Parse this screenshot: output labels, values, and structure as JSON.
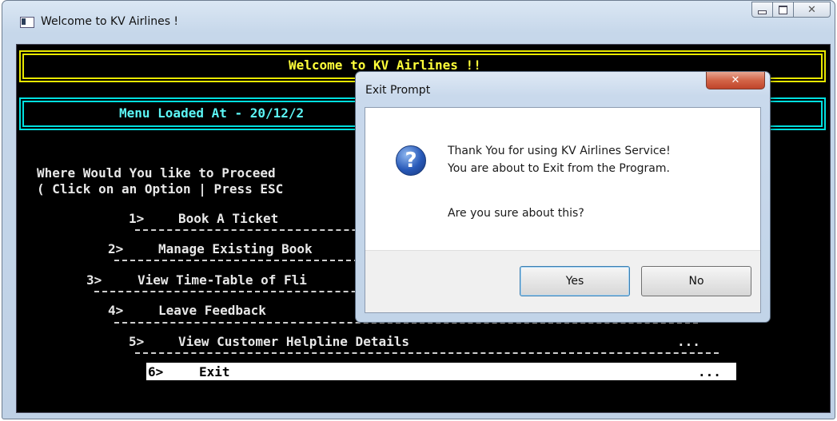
{
  "window": {
    "title": "Welcome to KV Airlines !",
    "controls": {
      "minimize": "",
      "maximize": "",
      "close": "✕"
    }
  },
  "console": {
    "banner": "Welcome to KV Airlines !!",
    "loaded": "Menu Loaded At - 20/12/2",
    "prompt_line1": "Where Would You like to Proceed",
    "prompt_line2": "( Click on an Option | Press ESC",
    "menu": [
      {
        "num": "1>",
        "label": "Book A Ticket"
      },
      {
        "num": "2>",
        "label": "Manage Existing Book"
      },
      {
        "num": "3>",
        "label": "View Time-Table of Fli"
      },
      {
        "num": "4>",
        "label": "Leave Feedback"
      },
      {
        "num": "5>",
        "label": "View Customer Helpline Details",
        "dots": "..."
      },
      {
        "num": "6>",
        "label": "Exit",
        "dots": "...",
        "selected": true
      }
    ]
  },
  "dialog": {
    "title": "Exit Prompt",
    "close_label": "✕",
    "icon": "question-icon",
    "message_line1": "Thank You for using KV Airlines Service!",
    "message_line2": "You are about to Exit from the Program.",
    "message_line3": "Are you sure about this?",
    "yes_label": "Yes",
    "no_label": "No"
  },
  "colors": {
    "console_bg": "#000000",
    "banner_yellow": "#ffff3a",
    "loaded_cyan": "#5cf6f6",
    "dialog_close": "#c8503a",
    "question_blue": "#2859b8"
  }
}
